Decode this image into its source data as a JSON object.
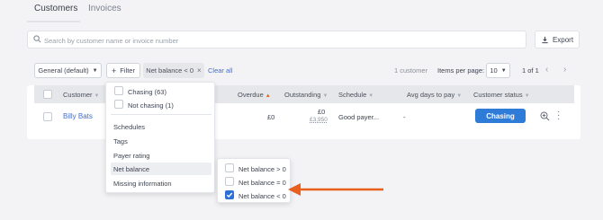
{
  "tabs": [
    {
      "label": "Customers"
    },
    {
      "label": "Invoices"
    }
  ],
  "search": {
    "placeholder": "Search by customer name or invoice number"
  },
  "export_label": "Export",
  "toolbar": {
    "view": "General (default)",
    "filter": "Filter",
    "chip": "Net balance < 0",
    "clear_all": "Clear all",
    "count": "1 customer",
    "items_per_page_label": "Items per page:",
    "items_per_page": "10",
    "pagination": "1 of 1"
  },
  "table": {
    "columns": [
      "Customer",
      "Overdue",
      "Outstanding",
      "Schedule",
      "Avg days to pay",
      "Customer status"
    ],
    "row": {
      "name": "Billy Bats",
      "overdue": "£0",
      "outstanding": "£0",
      "outstanding_sub": "£3,950",
      "schedule": "Good payer...",
      "avg_days": "-",
      "status": "Chasing"
    }
  },
  "filter_menu": {
    "options": [
      "Chasing (63)",
      "Not chasing (1)"
    ],
    "items": [
      "Schedules",
      "Tags",
      "Payer rating",
      "Net balance",
      "Missing information"
    ]
  },
  "net_balance_menu": {
    "options": [
      {
        "label": "Net balance > 0",
        "checked": false
      },
      {
        "label": "Net balance = 0",
        "checked": false
      },
      {
        "label": "Net balance < 0",
        "checked": true
      }
    ]
  },
  "colors": {
    "accent": "#2f7bd8",
    "arrow": "#e8601c"
  }
}
